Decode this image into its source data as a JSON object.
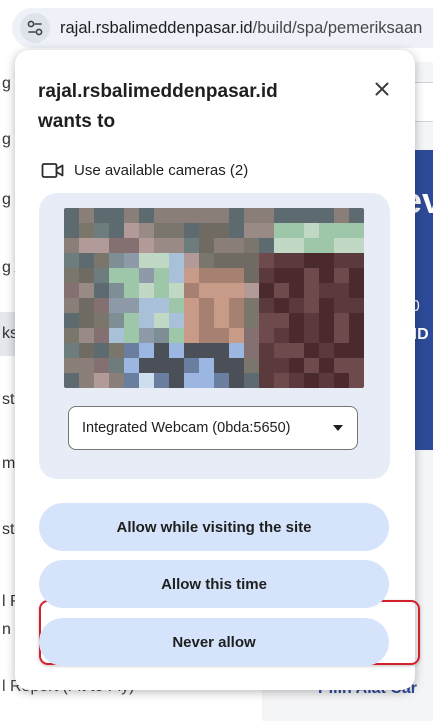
{
  "browser": {
    "url_host": "rajal.rsbalimeddenpasar.id",
    "url_path": "/build/spa/pemeriksaan"
  },
  "background_page": {
    "left_items": [
      "g R",
      "g K",
      "g K",
      "g A",
      "ks",
      "st",
      "m",
      "st",
      "l R",
      "n"
    ],
    "active_index": 4,
    "bottom_left_text": "l Report (Fit to Fly)",
    "right_input_text": "nu",
    "right_card_lines": [
      "ev",
      "ru",
      "00",
      "VID"
    ],
    "bottom_right_text": "Pilih Alat Car"
  },
  "permission_prompt": {
    "origin": "rajal.rsbalimeddenpasar.id",
    "wants_to": "wants to",
    "permission_label": "Use available cameras (2)",
    "camera_select": {
      "selected": "Integrated Webcam (0bda:5650)"
    },
    "buttons": {
      "allow_while_visiting": "Allow while visiting the site",
      "allow_this_time": "Allow this time",
      "never_allow": "Never allow"
    },
    "highlighted_button": "allow_this_time"
  },
  "icons": {
    "site_settings": "tune-icon",
    "close": "close-icon",
    "camera": "videocam-icon",
    "dropdown": "arrow-drop-down-icon"
  },
  "colors": {
    "button_bg": "#d6e4fb",
    "panel_bg": "#e8ecf7",
    "highlight_border": "#d3212c",
    "omnibox_bg": "#eef1f8",
    "accent_card": "#2d4a98"
  }
}
